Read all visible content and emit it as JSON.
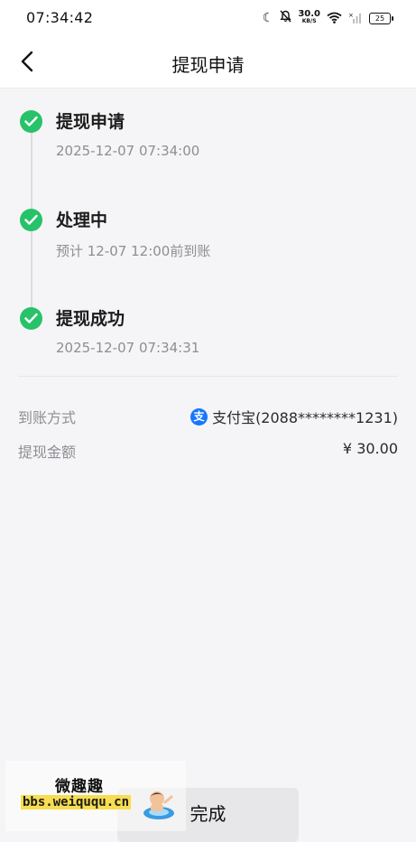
{
  "status_bar": {
    "time": "07:34:42",
    "net_speed_value": "30.0",
    "net_speed_unit": "KB/S",
    "battery": "25"
  },
  "header": {
    "title": "提现申请"
  },
  "timeline": {
    "steps": [
      {
        "title": "提现申请",
        "subtitle": "2025-12-07 07:34:00"
      },
      {
        "title": "处理中",
        "subtitle": "预计 12-07 12:00前到账"
      },
      {
        "title": "提现成功",
        "subtitle": "2025-12-07 07:34:31"
      }
    ]
  },
  "details": {
    "method_label": "到账方式",
    "method_icon_text": "支",
    "method_value": "支付宝(2088********1231)",
    "amount_label": "提现金额",
    "amount_value": "¥ 30.00"
  },
  "footer": {
    "done_label": "完成"
  },
  "watermark": {
    "name": "微趣趣",
    "url": "bbs.weiququ.cn"
  },
  "colors": {
    "success_green": "#27c26a",
    "alipay_blue": "#1677ff",
    "page_bg": "#f5f5f7"
  }
}
